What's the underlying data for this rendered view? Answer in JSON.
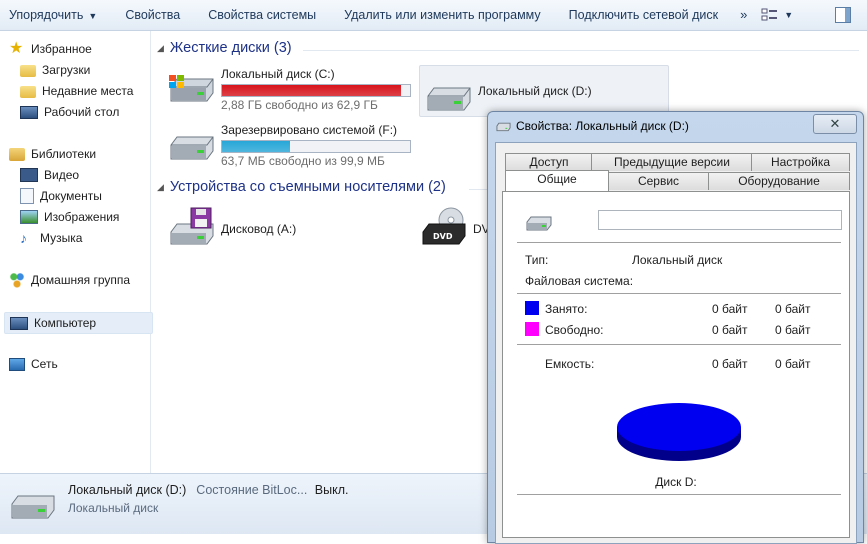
{
  "toolbar": {
    "organize": "Упорядочить",
    "properties": "Свойства",
    "system_properties": "Свойства системы",
    "uninstall": "Удалить или изменить программу",
    "map_drive": "Подключить сетевой диск",
    "more": "»"
  },
  "nav": {
    "favorites": "Избранное",
    "downloads": "Загрузки",
    "recent": "Недавние места",
    "desktop": "Рабочий стол",
    "libraries": "Библиотеки",
    "video": "Видео",
    "documents": "Документы",
    "images": "Изображения",
    "music": "Музыка",
    "homegroup": "Домашняя группа",
    "computer": "Компьютер",
    "network": "Сеть"
  },
  "groups": {
    "hard_disks": "Жесткие диски (3)",
    "removable": "Устройства со съемными носителями (2)"
  },
  "drives": {
    "c": {
      "name": "Локальный диск (C:)",
      "free": "2,88 ГБ свободно из 62,9 ГБ",
      "used_fraction": 0.954,
      "bar_color": "#d8141c"
    },
    "d": {
      "name": "Локальный диск (D:)"
    },
    "f": {
      "name": "Зарезервировано системой (F:)",
      "free": "63,7 МБ свободно из 99,9 МБ",
      "used_fraction": 0.362,
      "bar_color": "#27a7d8"
    },
    "a": {
      "name": "Дисковод (A:)"
    },
    "dvd": {
      "name": "DV",
      "badge": "DVD"
    }
  },
  "details": {
    "title": "Локальный диск (D:)",
    "bitlocker_key": "Состояние BitLoc...",
    "bitlocker_val": "Выкл.",
    "type": "Локальный диск"
  },
  "dialog": {
    "title": "Свойства: Локальный диск (D:)",
    "close": "✕",
    "tabs_row1": [
      "Доступ",
      "Предыдущие версии",
      "Настройка"
    ],
    "tabs_row2": [
      "Общие",
      "Сервис",
      "Оборудование"
    ],
    "type_label": "Тип:",
    "type_value": "Локальный диск",
    "fs_label": "Файловая система:",
    "used_label": "Занято:",
    "used_bytes": "0 байт",
    "used_size": "0 байт",
    "free_label": "Свободно:",
    "free_bytes": "0 байт",
    "free_size": "0 байт",
    "capacity_label": "Емкость:",
    "capacity_bytes": "0 байт",
    "capacity_size": "0 байт",
    "disk_label": "Диск D:",
    "used_color": "#0000f0",
    "free_color": "#ff00ff"
  }
}
